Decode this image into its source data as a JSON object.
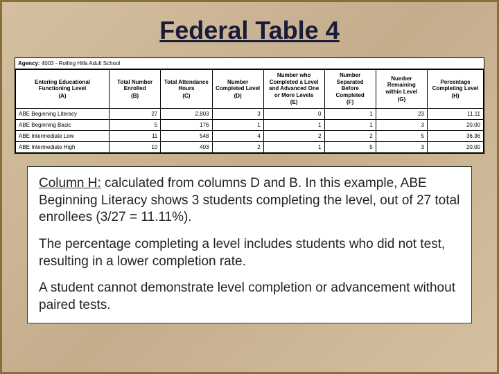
{
  "title": "Federal Table 4",
  "agency": {
    "label": "Agency:",
    "value": "4003 - Rolling Hills Adult School"
  },
  "columns": [
    {
      "head": "Entering Educational Functioning Level",
      "letter": "(A)"
    },
    {
      "head": "Total Number Enrolled",
      "letter": "(B)"
    },
    {
      "head": "Total Attendance Hours",
      "letter": "(C)"
    },
    {
      "head": "Number Completed Level",
      "letter": "(D)"
    },
    {
      "head": "Number who Completed a Level and Advanced One or More Levels",
      "letter": "(E)"
    },
    {
      "head": "Number Separated Before Completed",
      "letter": "(F)"
    },
    {
      "head": "Number Remaining within Level",
      "letter": "(G)"
    },
    {
      "head": "Percentage Completing Level",
      "letter": "(H)"
    }
  ],
  "rows": [
    {
      "label": "ABE Beginning Literacy",
      "b": "27",
      "c": "2,803",
      "d": "3",
      "e": "0",
      "f": "1",
      "g": "23",
      "h": "11.11"
    },
    {
      "label": "ABE Beginning Basic",
      "b": "5",
      "c": "176",
      "d": "1",
      "e": "1",
      "f": "1",
      "g": "3",
      "h": "20.00"
    },
    {
      "label": "ABE Intermediate Low",
      "b": "11",
      "c": "548",
      "d": "4",
      "e": "2",
      "f": "2",
      "g": "5",
      "h": "36.36"
    },
    {
      "label": "ABE Intermediate High",
      "b": "10",
      "c": "403",
      "d": "2",
      "e": "1",
      "f": "5",
      "g": "3",
      "h": "20.00"
    }
  ],
  "explain": {
    "col_label": "Column H:",
    "p1_rest": " calculated from columns D and B. In this example, ABE Beginning Literacy shows 3 students completing the level, out of 27 total enrollees (3/27 = 11.11%).",
    "p2": "The percentage completing a level includes students who did not test, resulting in a lower completion rate.",
    "p3": "A student cannot demonstrate level completion or advancement without paired tests."
  },
  "chart_data": {
    "type": "table",
    "title": "Federal Table 4",
    "columns": [
      "Entering Educational Functioning Level (A)",
      "Total Number Enrolled (B)",
      "Total Attendance Hours (C)",
      "Number Completed Level (D)",
      "Number who Completed a Level and Advanced One or More Levels (E)",
      "Number Separated Before Completed (F)",
      "Number Remaining within Level (G)",
      "Percentage Completing Level (H)"
    ],
    "rows": [
      [
        "ABE Beginning Literacy",
        27,
        2803,
        3,
        0,
        1,
        23,
        11.11
      ],
      [
        "ABE Beginning Basic",
        5,
        176,
        1,
        1,
        1,
        3,
        20.0
      ],
      [
        "ABE Intermediate Low",
        11,
        548,
        4,
        2,
        2,
        5,
        36.36
      ],
      [
        "ABE Intermediate High",
        10,
        403,
        2,
        1,
        5,
        3,
        20.0
      ]
    ]
  }
}
